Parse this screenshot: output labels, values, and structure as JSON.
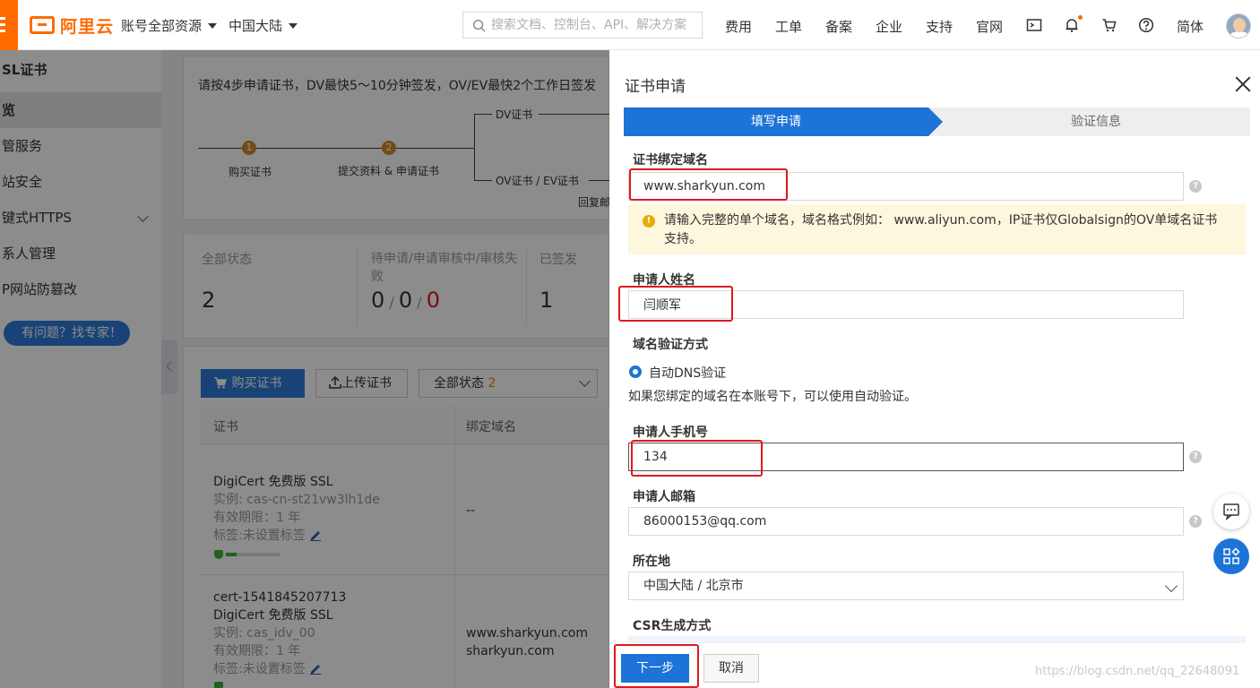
{
  "header": {
    "logo_text": "阿里云",
    "account_dropdown": "账号全部资源",
    "region_dropdown": "中国大陆",
    "search_placeholder": "搜索文档、控制台、API、解决方案",
    "nav": [
      "费用",
      "工单",
      "备案",
      "企业",
      "支持",
      "官网"
    ],
    "language": "简体",
    "icons": [
      "terminal-icon",
      "bell-icon",
      "cart-icon",
      "help-icon"
    ]
  },
  "sidebar": {
    "title": "SL证书",
    "items": [
      "览",
      "管服务",
      "站安全",
      "键式HTTPS",
      "系人管理",
      "P网站防篡改"
    ],
    "help_button": "有问题？找专家！"
  },
  "background": {
    "steps_hint": "请按4步申请证书，DV最快5～10分钟签发，OV/EV最快2个工作日签发",
    "steps": [
      "购买证书",
      "提交资料 & 申请证书"
    ],
    "step_numbers": [
      "1",
      "2"
    ],
    "branch_dv": "DV证书",
    "branch_ov": "OV证书 / EV证书",
    "branch_more": "回复邮",
    "stats": {
      "all_label": "全部状态",
      "all_value": "2",
      "pending_label": "待申请/申请审核中/审核失败",
      "pending_a": "0",
      "pending_b": "0",
      "pending_c": "0",
      "issued_label": "已签发",
      "issued_value": "1"
    },
    "buy_button": "购买证书",
    "upload_button": "上传证书",
    "status_filter": "全部状态",
    "status_count": "2",
    "table_headers": [
      "证书",
      "绑定域名"
    ],
    "rows": [
      {
        "name": "DigiCert 免费版 SSL",
        "instance": "实例: cas-cn-st21vw3lh1de",
        "validity": "有效期限：1 年",
        "tag": "标签:未设置标签",
        "domain": "--"
      },
      {
        "id": "cert-1541845207713",
        "name": "DigiCert 免费版 SSL",
        "instance": "实例: cas_idv_00",
        "validity": "有效期限：1 年",
        "tag": "标签:未设置标签",
        "domains": [
          "www.sharkyun.com",
          "sharkyun.com"
        ]
      }
    ]
  },
  "drawer": {
    "title": "证书申请",
    "steps": [
      "填写申请",
      "验证信息"
    ],
    "fields": {
      "domain_label": "证书绑定域名",
      "domain_value": "www.sharkyun.com",
      "domain_warning": "请输入完整的单个域名，域名格式例如： www.aliyun.com，IP证书仅Globalsign的OV单域名证书支持。",
      "name_label": "申请人姓名",
      "name_value": "闫顺军",
      "verify_label": "域名验证方式",
      "verify_option": "自动DNS验证",
      "verify_hint": "如果您绑定的域名在本账号下，可以使用自动验证。",
      "phone_label": "申请人手机号",
      "phone_value": "134",
      "email_label": "申请人邮箱",
      "email_value": "86000153@qq.com",
      "location_label": "所在地",
      "location_value": "中国大陆 / 北京市",
      "csr_label": "CSR生成方式"
    },
    "next_button": "下一步",
    "cancel_button": "取消",
    "help_mark": "?"
  },
  "watermark": "https://blog.csdn.net/qq_22648091",
  "colors": {
    "brand": "#ff6a00",
    "primary": "#1e73d8",
    "highlight": "#e0181e",
    "warning_bg": "#fdf7dd"
  }
}
